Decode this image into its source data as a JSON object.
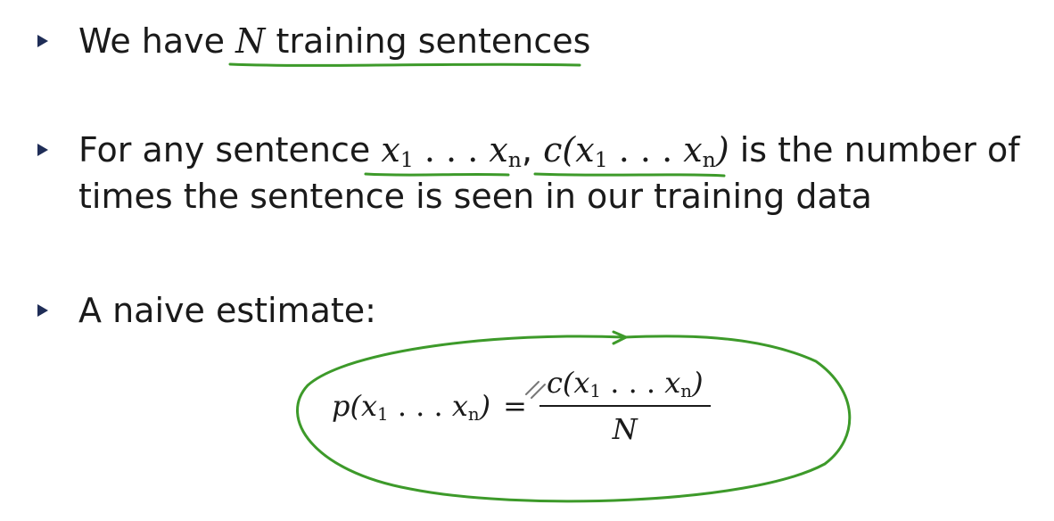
{
  "bullets": [
    {
      "pre": "We have ",
      "math": "N",
      "post": " training sentences"
    },
    {
      "line1_pre": "For any sentence ",
      "seq_x": "x",
      "seq_sub1": "1",
      "seq_dots": " . . . ",
      "seq_xn": "x",
      "seq_subn": "n",
      "comma": ", ",
      "count_c": "c(",
      "count_x": "x",
      "count_sub1": "1",
      "count_dots": " . . . ",
      "count_xn": "x",
      "count_subn": "n",
      "count_close": ")",
      "line1_post": " is the number of",
      "line2": "times the sentence is seen in our training data"
    },
    {
      "text": "A naive estimate:"
    }
  ],
  "formula": {
    "lhs_p": "p(",
    "lhs_x": "x",
    "lhs_sub1": "1",
    "lhs_dots": " . . . ",
    "lhs_xn": "x",
    "lhs_subn": "n",
    "lhs_close": ")",
    "equals": "=",
    "num_c": "c(",
    "num_x": "x",
    "num_sub1": "1",
    "num_dots": " . . . ",
    "num_xn": "x",
    "num_subn": "n",
    "num_close": ")",
    "denominator": "N"
  },
  "colors": {
    "bullet_marker": "#1f2d57",
    "annotation_ink": "#3d9a2a",
    "text": "#1a1a1a"
  }
}
